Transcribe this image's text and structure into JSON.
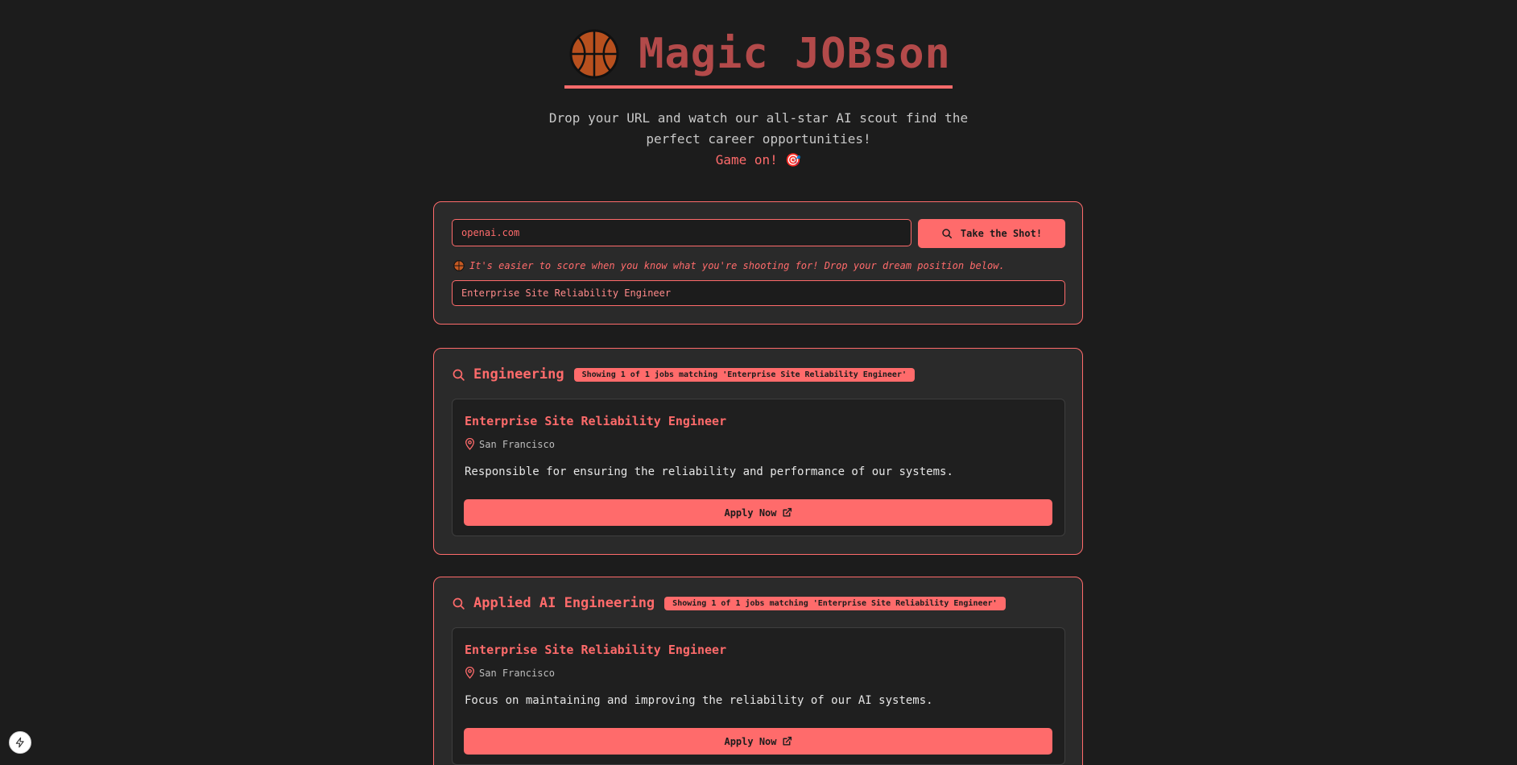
{
  "header": {
    "title": "Magic JOBson",
    "subtitle": "Drop your URL and watch our all-star AI scout find the perfect career opportunities!",
    "tagline": "Game on! 🎯"
  },
  "search": {
    "url_value": "openai.com",
    "submit_label": "Take the Shot!",
    "hint": "It's easier to score when you know what you're shooting for! Drop your dream position below.",
    "role_value": "Enterprise Site Reliability Engineer"
  },
  "categories": [
    {
      "name": "Engineering",
      "badge": "Showing 1 of 1 jobs matching 'Enterprise Site Reliability Engineer'",
      "jobs": [
        {
          "title": "Enterprise Site Reliability Engineer",
          "location": "San Francisco",
          "description": "Responsible for ensuring the reliability and performance of our systems.",
          "apply_label": "Apply Now"
        }
      ]
    },
    {
      "name": "Applied AI Engineering",
      "badge": "Showing 1 of 1 jobs matching 'Enterprise Site Reliability Engineer'",
      "jobs": [
        {
          "title": "Enterprise Site Reliability Engineer",
          "location": "San Francisco",
          "description": "Focus on maintaining and improving the reliability of our AI systems.",
          "apply_label": "Apply Now"
        }
      ]
    }
  ],
  "icons": {
    "logo": "basketball-icon",
    "search": "search-icon",
    "location": "map-pin-icon",
    "external": "external-link-icon",
    "dev": "lightning-icon"
  },
  "colors": {
    "background": "#1c1c1c",
    "panel": "#2a2a2a",
    "accent": "#ff6b6b",
    "title": "#b34a4a"
  }
}
